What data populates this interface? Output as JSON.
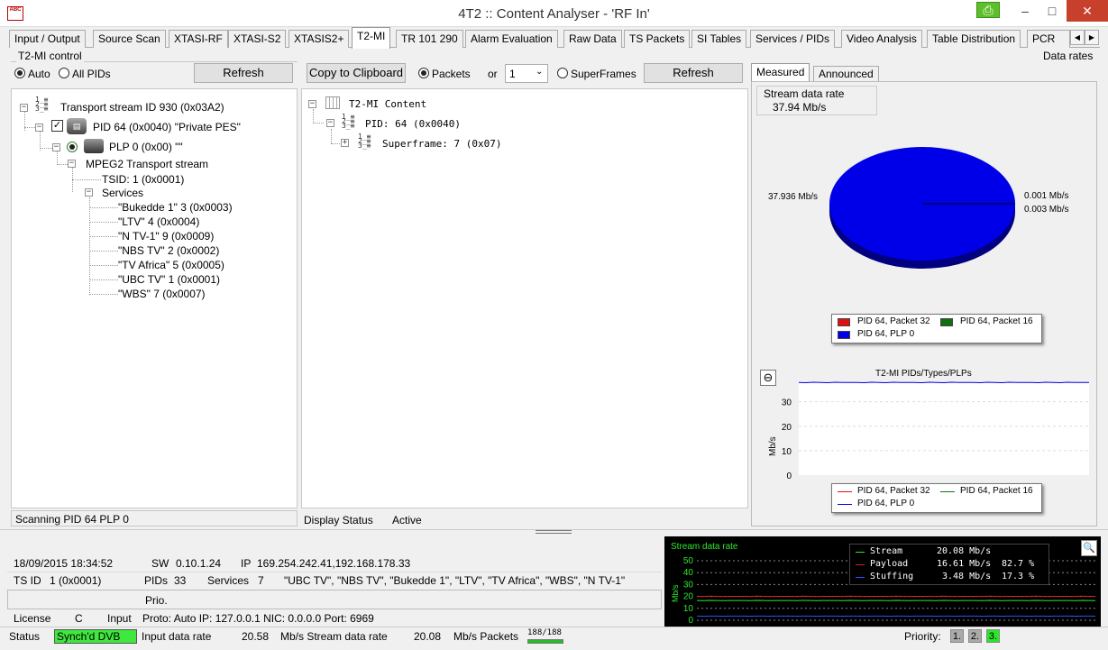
{
  "window": {
    "title": "4T2 :: Content Analyser - 'RF In'",
    "icon_text": "ABC",
    "minimize": "–",
    "maximize": "□",
    "close": "✕",
    "ext_icon": "⎙"
  },
  "tabs": [
    "Input / Output",
    "Source Scan",
    "XTASI-RF",
    "XTASI-S2",
    "XTASIS2+",
    "T2-MI",
    "TR 101 290",
    "Alarm Evaluation",
    "Raw Data",
    "TS Packets",
    "SI Tables",
    "Services / PIDs",
    "Video Analysis",
    "Table Distribution",
    "PCR"
  ],
  "active_tab": "T2-MI",
  "left_panel": {
    "group_title": "T2-MI control",
    "radio_auto": "Auto",
    "radio_all": "All PIDs",
    "refresh": "Refresh",
    "tree": {
      "ts": "Transport stream ID 930 (0x03A2)",
      "pid": "PID 64 (0x0040) \"Private PES\"",
      "plp": "PLP 0 (0x00) \"\"",
      "mpeg": "MPEG2 Transport stream",
      "tsid": "TSID: 1 (0x0001)",
      "services_label": "Services",
      "services": [
        "\"Bukedde 1\" 3 (0x0003)",
        "\"LTV\" 4 (0x0004)",
        "\"N TV-1\" 9 (0x0009)",
        "\"NBS TV\" 2 (0x0002)",
        "\"TV Africa\" 5 (0x0005)",
        "\"UBC TV\" 1 (0x0001)",
        "\"WBS\" 7 (0x0007)"
      ]
    },
    "status": "Scanning PID 64 PLP 0"
  },
  "middle_panel": {
    "copy": "Copy to Clipboard",
    "packets": "Packets",
    "or": "or",
    "select_value": "1",
    "superframes": "SuperFrames",
    "refresh": "Refresh",
    "tree": {
      "root": "T2-MI Content",
      "pid": "PID: 64 (0x0040)",
      "superframe": "Superframe: 7 (0x07)"
    },
    "display_status_label": "Display Status",
    "display_status_value": "Active"
  },
  "right_panel": {
    "title": "Data rates",
    "tab_measured": "Measured",
    "tab_announced": "Announced",
    "stream_rate_label": "Stream data rate",
    "stream_rate_value": "37.94 Mb/s",
    "pie_label_left": "37.936 Mb/s",
    "pie_label_right1": "0.001 Mb/s",
    "pie_label_right2": "0.003 Mb/s",
    "pie_legend": [
      "PID 64, Packet 32",
      "PID 64, Packet 16",
      "PID 64, PLP 0"
    ],
    "line_title": "T2-MI PIDs/Types/PLPs",
    "line_ylabel": "Mb/s",
    "line_yticks": [
      "30",
      "20",
      "10",
      "0"
    ],
    "line_legend": [
      "PID 64, Packet 32",
      "PID 64, Packet 16",
      "PID 64, PLP 0"
    ],
    "zoom_icon": "⊖"
  },
  "colors": {
    "red": "#e01010",
    "green": "#107010",
    "blue": "#0000e8"
  },
  "chart_data": [
    {
      "type": "pie",
      "title": "",
      "categories": [
        "PID 64, PLP 0",
        "PID 64, Packet 32",
        "PID 64, Packet 16"
      ],
      "values": [
        37.936,
        0.001,
        0.003
      ],
      "labels": [
        "37.936 Mb/s",
        "0.001 Mb/s",
        "0.003 Mb/s"
      ],
      "legend": "bottom"
    },
    {
      "type": "line",
      "title": "T2-MI PIDs/Types/PLPs",
      "ylabel": "Mb/s",
      "ylim": [
        0,
        38
      ],
      "yticks": [
        0,
        10,
        20,
        30
      ],
      "grid": true,
      "series": [
        {
          "name": "PID 64, Packet 32",
          "values": [
            0,
            0,
            0,
            0,
            0,
            0,
            0,
            0
          ]
        },
        {
          "name": "PID 64, Packet 16",
          "values": [
            0,
            0,
            0,
            0,
            0,
            0,
            0,
            0
          ]
        },
        {
          "name": "PID 64, PLP 0",
          "values": [
            37.9,
            37.8,
            38.0,
            37.9,
            37.8,
            38.0,
            37.9,
            37.9
          ]
        }
      ],
      "legend": "bottom"
    },
    {
      "type": "line",
      "title": "Stream data rate",
      "ylim": [
        0,
        50
      ],
      "yticks": [
        0,
        10,
        20,
        30,
        40,
        50
      ],
      "ylabel": "Mb/s",
      "grid": true,
      "series": [
        {
          "name": "Stream",
          "values": [
            20.1,
            20.0,
            20.2,
            20.1,
            20.0,
            20.1,
            20.08
          ]
        },
        {
          "name": "Payload",
          "values": [
            16.6,
            16.5,
            16.7,
            16.6,
            16.5,
            16.6,
            16.61
          ]
        },
        {
          "name": "Stuffing",
          "values": [
            3.5,
            3.4,
            3.5,
            3.5,
            3.4,
            3.5,
            3.48
          ]
        }
      ],
      "legend": "top-right"
    }
  ],
  "footer": {
    "datetime": "18/09/2015 18:34:52",
    "sw_label": "SW",
    "sw_value": "0.10.1.24",
    "ip_label": "IP",
    "ip_value": "169.254.242.41,192.168.178.33",
    "tsid_label": "TS ID",
    "tsid_value": "1 (0x0001)",
    "pids_label": "PIDs",
    "pids_value": "33",
    "services_label": "Services",
    "services_value": "7",
    "services_list": "\"UBC TV\", \"NBS TV\", \"Bukedde 1\", \"LTV\", \"TV Africa\", \"WBS\", \"N TV-1\"",
    "prio": "Prio.",
    "license_label": "License",
    "license_value": "C",
    "input_label": "Input",
    "input_value": "Proto: Auto IP: 127.0.0.1 NIC: 0.0.0.0 Port: 6969",
    "status_label": "Status",
    "status_value": "Synch'd DVB",
    "input_rate_label": "Input data rate",
    "input_rate_value": "20.58",
    "input_rate_unit": "Mb/s Stream data rate",
    "stream_rate_value": "20.08",
    "packets_label": "Mb/s Packets",
    "packets_value": "188/188",
    "packets_fill": 1.0,
    "priority_label": "Priority:",
    "priorities": [
      "1.",
      "2.",
      "3."
    ]
  },
  "mini_graph": {
    "title": "Stream data rate",
    "ylabel": "Mb/s",
    "yticks": [
      "50",
      "40",
      "30",
      "20",
      "10",
      "0"
    ],
    "legend": [
      {
        "name": "Stream",
        "value": "20.08 Mb/s",
        "pct": ""
      },
      {
        "name": "Payload",
        "value": "16.61 Mb/s",
        "pct": "82.7 %"
      },
      {
        "name": "Stuffing",
        "value": "3.48 Mb/s",
        "pct": "17.3 %"
      }
    ],
    "zoom_icon": "🔍"
  }
}
